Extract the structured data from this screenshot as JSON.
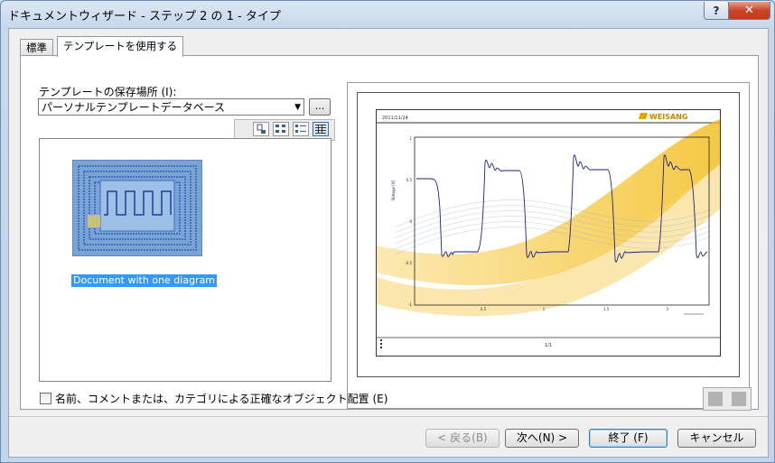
{
  "window": {
    "title": "ドキュメントウィザード - ステップ 2 の 1 - タイプ",
    "help_label": "?",
    "close_label": "✕"
  },
  "tabs": [
    {
      "label": "標準"
    },
    {
      "label": "テンプレートを使用する"
    }
  ],
  "template": {
    "location_label": "テンプレートの保存場所 (I):",
    "location_value": "パーソナルテンプレートデータベース",
    "browse_label": "...",
    "items": [
      {
        "label": "Document with one diagram"
      }
    ]
  },
  "icons": {
    "view": [
      "large-icons-icon",
      "small-icons-icon",
      "list-icon",
      "details-icon"
    ],
    "nav": [
      "previous-page-icon",
      "next-page-icon"
    ]
  },
  "preview": {
    "date": "2011/11/24",
    "logo_text": "WEISANG",
    "page_number": "1/1",
    "y_axis_label": "Voltage [V]",
    "y_ticks": [
      "1",
      "0.5",
      "0",
      "-0.5",
      "-1"
    ],
    "x_ticks": [
      "0.5",
      "1",
      "1.5",
      "2"
    ],
    "colors": {
      "signal": "#1a237e",
      "wave": "#f2b705",
      "mesh": "#9fb5cf"
    }
  },
  "options": {
    "precise_placement_label": "名前、コメントまたは、カテゴリによる正確なオブジェクト配置 (E)"
  },
  "buttons": {
    "back": "< 戻る(B)",
    "next": "次へ(N) >",
    "finish": "終了 (F)",
    "cancel": "キャンセル"
  }
}
